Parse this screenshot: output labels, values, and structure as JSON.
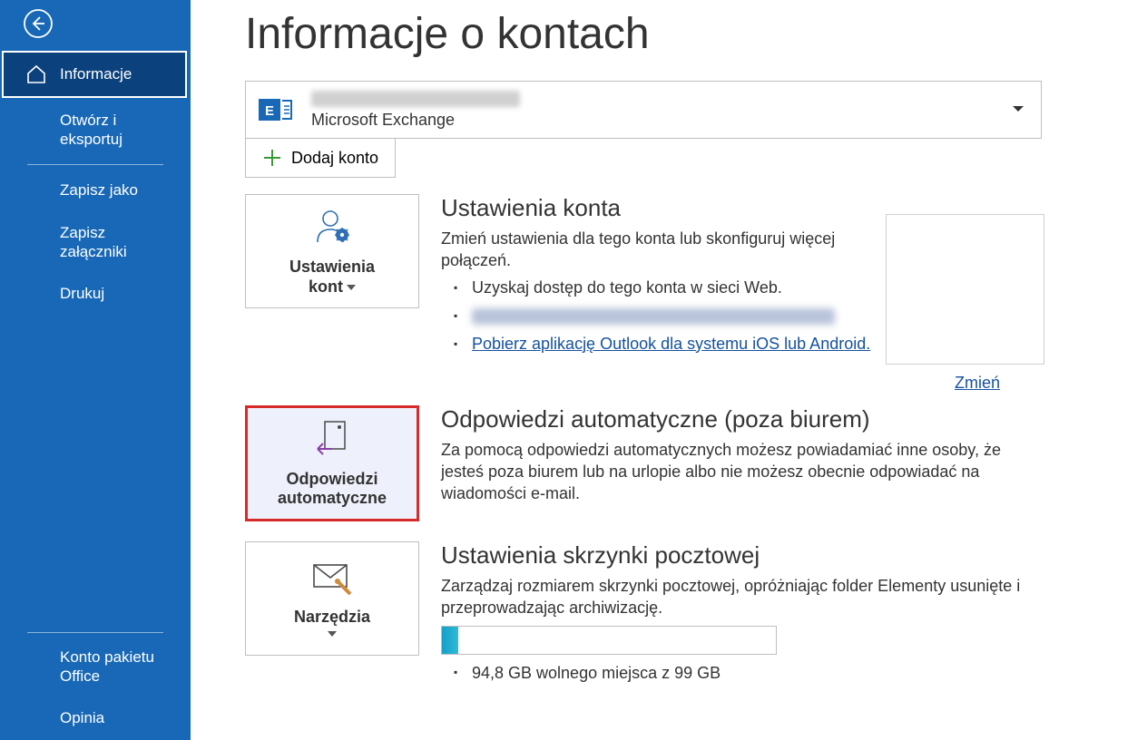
{
  "sidebar": {
    "items": [
      {
        "label": "Informacje"
      },
      {
        "label": "Otwórz i eksportuj"
      },
      {
        "label": "Zapisz jako"
      },
      {
        "label": "Zapisz załączniki"
      },
      {
        "label": "Drukuj"
      },
      {
        "label": "Konto pakietu Office"
      },
      {
        "label": "Opinia"
      }
    ]
  },
  "page_title": "Informacje o kontach",
  "account": {
    "type": "Microsoft Exchange"
  },
  "add_account": "Dodaj konto",
  "tiles": {
    "account_settings": {
      "line1": "Ustawienia",
      "line2": "kont"
    },
    "auto_replies": {
      "line1": "Odpowiedzi",
      "line2": "automatyczne"
    },
    "tools": "Narzędzia"
  },
  "sections": {
    "acct": {
      "title": "Ustawienia konta",
      "desc": "Zmień ustawienia dla tego konta lub skonfiguruj więcej połączeń.",
      "bullet1": "Uzyskaj dostęp do tego konta w sieci Web.",
      "bullet3": "Pobierz aplikację Outlook dla systemu iOS lub Android.",
      "change": "Zmień"
    },
    "oof": {
      "title": "Odpowiedzi automatyczne (poza biurem)",
      "desc": "Za pomocą odpowiedzi automatycznych możesz powiadamiać inne osoby, że jesteś poza biurem lub na urlopie albo nie możesz obecnie odpowiadać na wiadomości e-mail."
    },
    "mailbox": {
      "title": "Ustawienia skrzynki pocztowej",
      "desc": "Zarządzaj rozmiarem skrzynki pocztowej, opróżniając folder Elementy usunięte i przeprowadzając archiwizację.",
      "storage": "94,8 GB wolnego miejsca z 99 GB"
    }
  }
}
